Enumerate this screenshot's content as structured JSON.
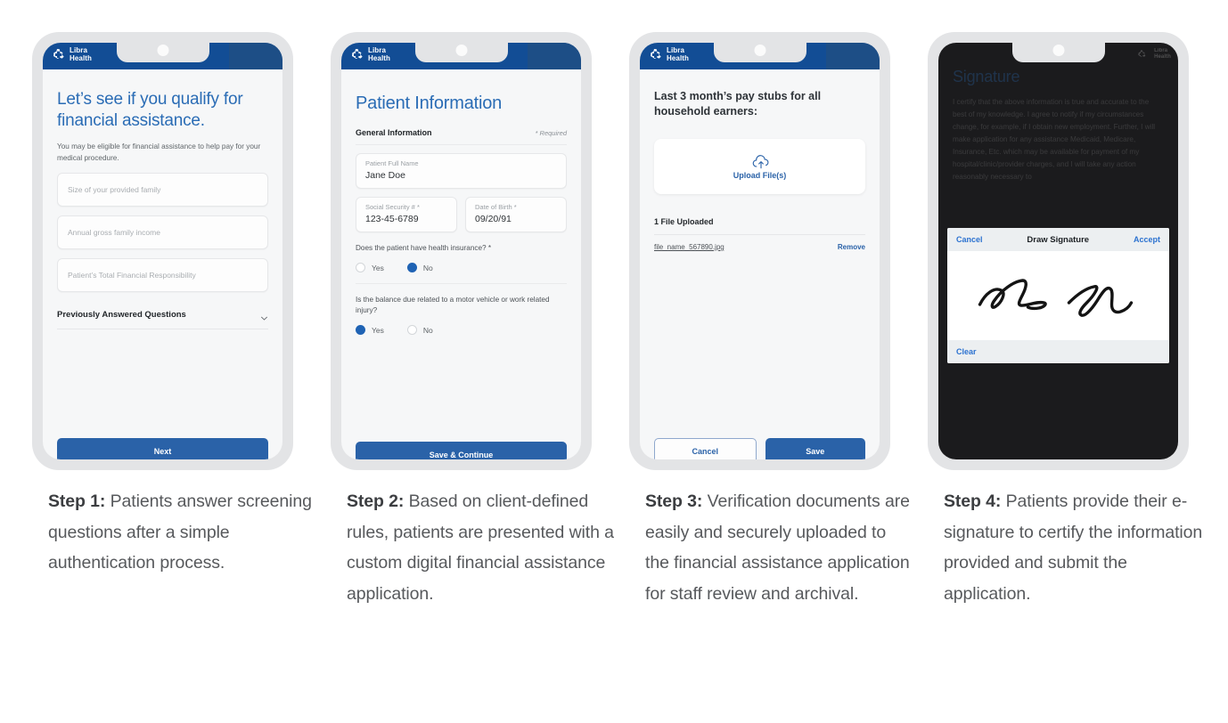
{
  "brand": {
    "name_line1": "Libra",
    "name_line2": "Health",
    "logo_icon": "medical-cross-icon",
    "header_color": "#124d95",
    "accent_color": "#2a62a8",
    "heading_color": "#2a6cb5"
  },
  "steps": [
    {
      "caption_label": "Step 1:",
      "caption_text": " Patients answer screening questions after a simple authentication process.",
      "screen": {
        "heading": "Let’s see if you qualify for financial assistance.",
        "subtext": "You may be eligible for financial assistance to help pay for your medical procedure.",
        "fields": [
          {
            "placeholder": "Size of your provided family"
          },
          {
            "placeholder": "Annual gross family income"
          },
          {
            "placeholder": "Patient’s Total Financial Responsibility"
          }
        ],
        "accordion": {
          "label": "Previously Answered Questions",
          "icon": "chevron-down-icon"
        },
        "primary_button": "Next"
      }
    },
    {
      "caption_label": "Step 2:",
      "caption_text": " Based on client-defined rules, patients are presented with a custom digital financial assistance application.",
      "screen": {
        "heading": "Patient Information",
        "section_title": "General Information",
        "required_note": "* Required",
        "fields": [
          {
            "label": "Patient Full Name",
            "value": "Jane Doe"
          },
          {
            "label": "Social Security # *",
            "value": "123-45-6789"
          },
          {
            "label": "Date of Birth *",
            "value": "09/20/91"
          }
        ],
        "questions": [
          {
            "text": "Does the patient have health insurance? *",
            "options": [
              {
                "label": "Yes",
                "selected": false
              },
              {
                "label": "No",
                "selected": true
              }
            ]
          },
          {
            "text": "Is the balance due related to a motor vehicle or work related injury?",
            "options": [
              {
                "label": "Yes",
                "selected": true
              },
              {
                "label": "No",
                "selected": false
              }
            ]
          }
        ],
        "primary_button": "Save & Continue"
      }
    },
    {
      "caption_label": "Step 3:",
      "caption_text": " Verification documents are easily and securely uploaded to the financial assistance application for staff review and archival.",
      "screen": {
        "heading": "Last 3 month’s pay stubs for all household earners:",
        "upload": {
          "icon": "cloud-upload-icon",
          "label": "Upload File(s)"
        },
        "uploaded_header": "1 File Uploaded",
        "file": {
          "name": "file_name_567890.jpg",
          "remove_label": "Remove"
        },
        "cancel_button": "Cancel",
        "save_button": "Save"
      }
    },
    {
      "caption_label": "Step 4:",
      "caption_text": " Patients provide their e-signature to certify the information provided and submit the application.",
      "screen": {
        "heading": "Signature",
        "legal_text": "I certify that the above information is true and accurate to the best of my knowledge. I agree to notify if my circumstances change, for example, if I obtain new employment. Further, I will make application for any assistance Medicaid, Medicare, Insurance, Etc. which may be available for payment of my hospital/clinic/provider charges, and I will take any action reasonably necessary to",
        "dialog": {
          "cancel_label": "Cancel",
          "title": "Draw Signature",
          "accept_label": "Accept",
          "clear_label": "Clear",
          "signature_alt": "handwritten-signature"
        }
      }
    }
  ]
}
